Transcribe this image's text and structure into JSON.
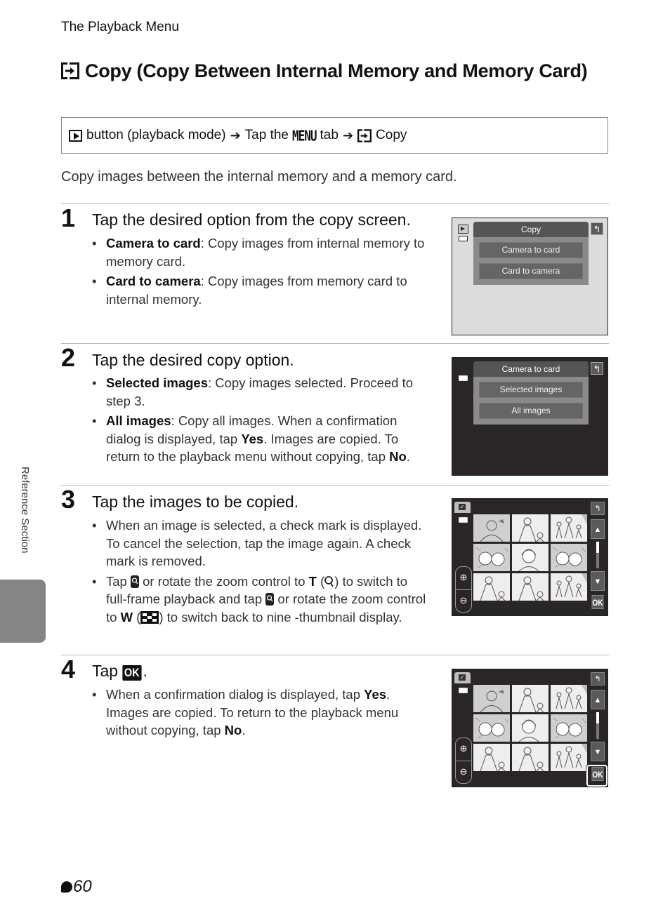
{
  "running_head": "The Playback Menu",
  "title": {
    "icon": "copy-icon",
    "text": "Copy (Copy Between Internal Memory and Memory Card)"
  },
  "navigation": {
    "start_icon": "playback-button-icon",
    "part1": "button (playback mode)",
    "arrow": "➔",
    "part2_prefix": "Tap the",
    "menu_word": "MENU",
    "part2_suffix": "tab",
    "end_icon": "copy-icon",
    "part3": "Copy"
  },
  "intro": "Copy images between the internal memory and a memory card.",
  "steps": [
    {
      "number": "1",
      "title": "Tap the desired option from the copy screen.",
      "bullets": [
        {
          "term": "Camera to card",
          "text": ": Copy images from internal memory to memory card."
        },
        {
          "term": "Card to camera",
          "text": ": Copy images from memory card to internal memory."
        }
      ],
      "screen": {
        "theme": "light",
        "menu_title": "Copy",
        "options": [
          "Camera to card",
          "Card to camera"
        ]
      }
    },
    {
      "number": "2",
      "title": "Tap the desired copy option.",
      "bullets": [
        {
          "term": "Selected images",
          "text": ": Copy images selected. Proceed to step 3."
        },
        {
          "term": "All images",
          "text": ": Copy all images. When a confirmation dialog is displayed, tap ",
          "term2": "Yes",
          "text2": ". Images are copied. To return to the playback menu without copying, tap ",
          "term3": "No",
          "text3": "."
        }
      ],
      "screen": {
        "theme": "dark",
        "menu_title": "Camera to card",
        "options": [
          "Selected images",
          "All images"
        ]
      }
    },
    {
      "number": "3",
      "title": "Tap the images to be copied.",
      "bullets": [
        {
          "text": "When an image is selected, a check mark is displayed. To cancel the selection, tap the image again. A check mark is removed."
        },
        {
          "p1": "Tap",
          "p2": "or rotate the zoom control to",
          "t": "T",
          "p3": "to switch to full-frame playback and tap",
          "p4": "or rotate the zoom control to",
          "w": "W",
          "p5": "to switch back to nine -thumbnail display."
        }
      ],
      "screen": {
        "theme": "dark",
        "ok_label": "OK",
        "highlight_ok": false
      }
    },
    {
      "number": "4",
      "title_prefix": "Tap",
      "title_ok": "OK",
      "title_suffix": ".",
      "bullets": [
        {
          "text": "When a confirmation dialog is displayed, tap ",
          "term": "Yes",
          "text2": ". Images are copied. To return to the playback menu without copying, tap ",
          "term2": "No",
          "text3": "."
        }
      ],
      "screen": {
        "theme": "dark",
        "ok_label": "OK",
        "highlight_ok": true
      }
    }
  ],
  "side_label": "Reference Section",
  "page_number": "60",
  "page_prefix_icon": "reference-e-icon"
}
